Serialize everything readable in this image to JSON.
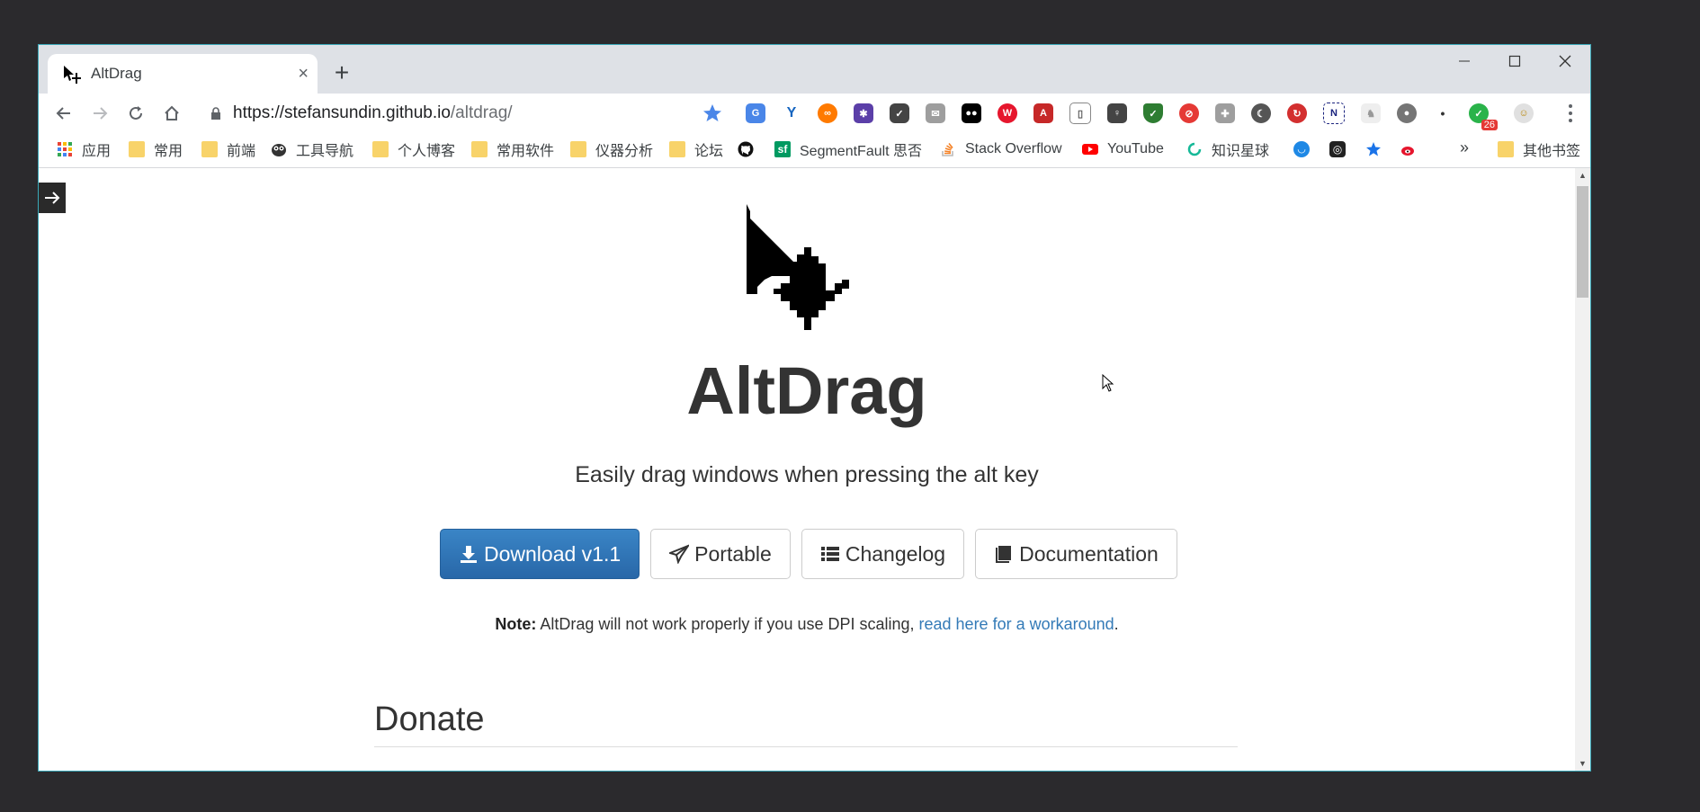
{
  "browser": {
    "tab": {
      "title": "AltDrag"
    },
    "url": {
      "host": "https://stefansundin.github.io",
      "path": "/altdrag/"
    },
    "extension_badge": "26"
  },
  "bookmarks": [
    {
      "label": "应用",
      "icon": "apps-grid-icon"
    },
    {
      "label": "常用",
      "icon": "folder-icon"
    },
    {
      "label": "前端",
      "icon": "folder-icon"
    },
    {
      "label": "工具导航",
      "icon": "owl-icon"
    },
    {
      "label": "个人博客",
      "icon": "folder-icon"
    },
    {
      "label": "常用软件",
      "icon": "folder-icon"
    },
    {
      "label": "仪器分析",
      "icon": "folder-icon"
    },
    {
      "label": "论坛",
      "icon": "folder-icon"
    },
    {
      "label": "SegmentFault 思否",
      "icon": "segmentfault-icon"
    },
    {
      "label": "Stack Overflow",
      "icon": "stackoverflow-icon"
    },
    {
      "label": "YouTube",
      "icon": "youtube-icon"
    },
    {
      "label": "知识星球",
      "icon": "zsxq-icon"
    },
    {
      "label": "其他书签",
      "icon": "folder-icon"
    }
  ],
  "bookmarks_overflow": "»",
  "page": {
    "title": "AltDrag",
    "tagline": "Easily drag windows when pressing the alt key",
    "buttons": {
      "download": "Download v1.1",
      "portable": "Portable",
      "changelog": "Changelog",
      "documentation": "Documentation"
    },
    "note": {
      "label": "Note:",
      "text": " AltDrag will not work properly if you use DPI scaling, ",
      "link": "read here for a workaround",
      "end": "."
    },
    "donate_heading": "Donate"
  },
  "colors": {
    "primary_button": "#2d6fb0",
    "link": "#337ab7",
    "star_blue": "#4a86e8",
    "youtube_red": "#ff0000"
  }
}
